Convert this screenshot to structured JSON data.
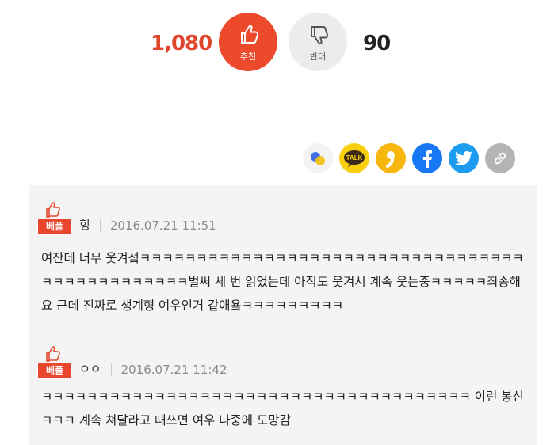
{
  "vote": {
    "up_count": "1,080",
    "up_label": "추천",
    "down_label": "반대",
    "down_count": "90",
    "up_color": "#ec4a2b"
  },
  "share": {
    "items": [
      "band-icon",
      "kakaotalk-icon",
      "kakaostory-icon",
      "facebook-icon",
      "twitter-icon",
      "link-icon"
    ],
    "kakao_label": "TALK"
  },
  "comments": [
    {
      "badge": "베플",
      "name": "힝",
      "date": "2016.07.21 11:51",
      "text": "여잔데 너무 웃겨섴ㅋㅋㅋㅋㅋㅋㅋㅋㅋㅋㅋㅋㅋㅋㅋㅋㅋㅋㅋㅋㅋㅋㅋㅋㅋㅋㅋㅋㅋㅋㅋㅋㅋㅋㅋㅋㅋㅋㅋㅋㅋㅋㅋㅋㅋㅋㅋ벌써 세 번 읽었는데 아직도 웃겨서 계속 웃는중ㅋㅋㅋㅋㅋ죄송해요 근데 진짜로 생계형 여우인거 같애욬ㅋㅋㅋㅋㅋㅋㅋㅋㅋ"
    },
    {
      "badge": "베플",
      "name": "ㅇㅇ",
      "date": "2016.07.21 11:42",
      "text": "ㅋㅋㅋㅋㅋㅋㅋㅋㅋㅋㅋㅋㅋㅋㅋㅋㅋㅋㅋㅋㅋㅋㅋㅋㅋㅋㅋㅋㅋㅋㅋㅋㅋㅋㅋㅋㅋㅋ 이런 봉신 ㅋㅋㅋ 계속 쳐달라고 때쓰면 여우 나중에 도망감"
    }
  ]
}
